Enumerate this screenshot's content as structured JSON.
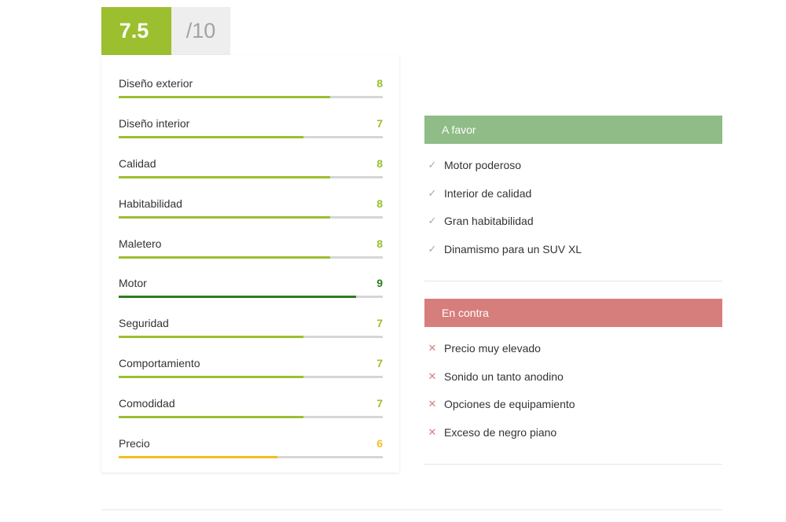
{
  "score": {
    "value": "7.5",
    "max": "/10"
  },
  "ratings": [
    {
      "label": "Diseño exterior",
      "value": "8",
      "fraction": 0.8,
      "color": "#9bbf2f"
    },
    {
      "label": "Diseño interior",
      "value": "7",
      "fraction": 0.7,
      "color": "#9bbf2f"
    },
    {
      "label": "Calidad",
      "value": "8",
      "fraction": 0.8,
      "color": "#9bbf2f"
    },
    {
      "label": "Habitabilidad",
      "value": "8",
      "fraction": 0.8,
      "color": "#9bbf2f"
    },
    {
      "label": "Maletero",
      "value": "8",
      "fraction": 0.8,
      "color": "#9bbf2f"
    },
    {
      "label": "Motor",
      "value": "9",
      "fraction": 0.9,
      "color": "#2e7d1e"
    },
    {
      "label": "Seguridad",
      "value": "7",
      "fraction": 0.7,
      "color": "#9bbf2f"
    },
    {
      "label": "Comportamiento",
      "value": "7",
      "fraction": 0.7,
      "color": "#9bbf2f"
    },
    {
      "label": "Comodidad",
      "value": "7",
      "fraction": 0.7,
      "color": "#9bbf2f"
    },
    {
      "label": "Precio",
      "value": "6",
      "fraction": 0.6,
      "color": "#f0c020"
    }
  ],
  "pros": {
    "title": "A favor",
    "color": "#8fbc87",
    "icon": "check-icon",
    "items": [
      "Motor poderoso",
      "Interior de calidad",
      "Gran habitabilidad",
      "Dinamismo para un SUV XL"
    ]
  },
  "cons": {
    "title": "En contra",
    "color": "#d67e7c",
    "icon": "cross-icon",
    "items": [
      "Precio muy elevado",
      "Sonido un tanto anodino",
      "Opciones de equipamiento",
      "Exceso de negro piano"
    ]
  }
}
